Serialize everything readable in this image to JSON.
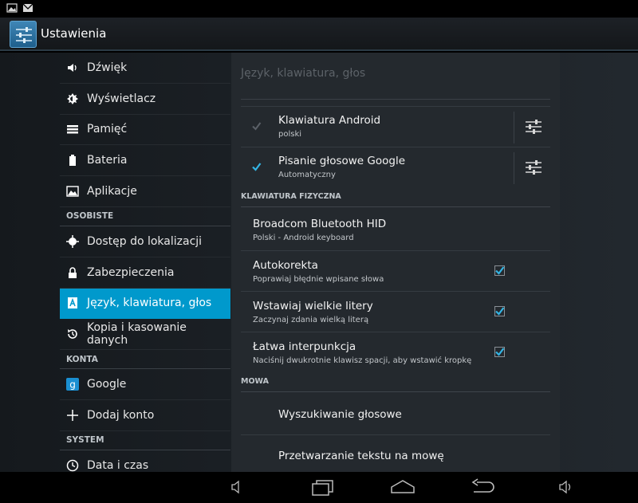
{
  "status_bar": {
    "icons": [
      "image-icon",
      "mail-icon"
    ]
  },
  "action_bar": {
    "title": "Ustawienia",
    "icon": "settings-icon"
  },
  "sidebar": {
    "items_top": [
      {
        "label": "Dźwięk",
        "icon": "volume-icon"
      },
      {
        "label": "Wyświetlacz",
        "icon": "brightness-icon"
      },
      {
        "label": "Pamięć",
        "icon": "storage-icon"
      },
      {
        "label": "Bateria",
        "icon": "battery-icon"
      },
      {
        "label": "Aplikacje",
        "icon": "apps-icon"
      }
    ],
    "section_personal": "OSOBISTE",
    "items_personal": [
      {
        "label": "Dostęp do lokalizacji",
        "icon": "location-icon"
      },
      {
        "label": "Zabezpieczenia",
        "icon": "lock-icon"
      },
      {
        "label": "Język, klawiatura, głos",
        "icon": "keyboard-icon",
        "active": true
      },
      {
        "label": "Kopia i kasowanie danych",
        "icon": "backup-icon"
      }
    ],
    "section_accounts": "KONTA",
    "items_accounts": [
      {
        "label": "Google",
        "icon": "google-icon"
      },
      {
        "label": "Dodaj konto",
        "icon": "plus-icon"
      }
    ],
    "section_system": "SYSTEM",
    "items_system": [
      {
        "label": "Data i czas",
        "icon": "clock-icon"
      }
    ]
  },
  "panel": {
    "heading": "Język, klawiatura, głos",
    "keyboards": [
      {
        "title": "Klawiatura Android",
        "subtitle": "polski",
        "checked": true,
        "disabled": true
      },
      {
        "title": "Pisanie głosowe Google",
        "subtitle": "Automatyczny",
        "checked": true,
        "disabled": false
      }
    ],
    "section_physical": "KLAWIATURA FIZYCZNA",
    "physical": [
      {
        "title": "Broadcom Bluetooth HID",
        "subtitle": "Polski - Android keyboard"
      },
      {
        "title": "Autokorekta",
        "subtitle": "Poprawiaj błędnie wpisane słowa",
        "checked": true
      },
      {
        "title": "Wstawiaj wielkie litery",
        "subtitle": "Zaczynaj zdania wielką literą",
        "checked": true
      },
      {
        "title": "Łatwa interpunkcja",
        "subtitle": "Naciśnij dwukrotnie klawisz spacji, aby wstawić kropkę",
        "checked": true
      }
    ],
    "section_speech": "MOWA",
    "speech": [
      {
        "title": "Wyszukiwanie głosowe"
      },
      {
        "title": "Przetwarzanie tekstu na mowę"
      }
    ]
  },
  "nav_bar": {
    "buttons": [
      "volume-down-icon",
      "recent-apps-icon",
      "home-icon",
      "back-icon",
      "volume-up-icon"
    ]
  },
  "colors": {
    "accent": "#0099cc",
    "checkbox": "#33b5e5",
    "background": "#24292e"
  }
}
